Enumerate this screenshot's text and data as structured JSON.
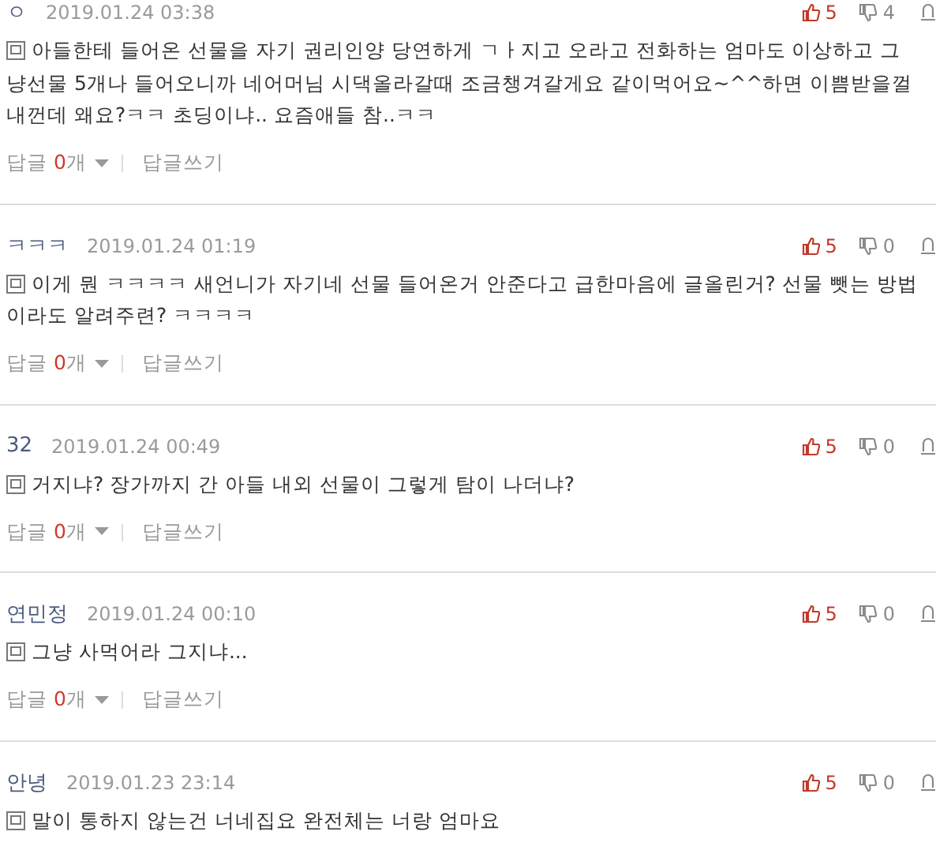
{
  "comments": [
    {
      "author": "ㅇ",
      "date": "2019.01.24 03:38",
      "likes": "5",
      "dislikes": "4",
      "text": "아들한테 들어온 선물을 자기 권리인양 당연하게 ㄱㅏ지고 오라고 전화하는 엄마도 이상하고 그냥선물 5개나 들어오니까 네어머님 시댁올라갈때 조금챙겨갈게요 같이먹어요~^^하면 이쁨받을껄 내껀데 왜요?ㅋㅋ 초딩이냐.. 요즘애들 참..ㅋㅋ",
      "reply_label": "답글",
      "reply_count": "0",
      "reply_unit": "개",
      "write_label": "답글쓰기"
    },
    {
      "author": "ㅋㅋㅋ",
      "date": "2019.01.24 01:19",
      "likes": "5",
      "dislikes": "0",
      "text": "이게 뭔 ㅋㅋㅋㅋ 새언니가 자기네 선물 들어온거 안준다고 급한마음에 글올린거? 선물 뺏는 방법이라도 알려주련? ㅋㅋㅋㅋ",
      "reply_label": "답글",
      "reply_count": "0",
      "reply_unit": "개",
      "write_label": "답글쓰기"
    },
    {
      "author": "32",
      "date": "2019.01.24 00:49",
      "likes": "5",
      "dislikes": "0",
      "text": "거지냐? 장가까지 간 아들 내외 선물이 그렇게 탐이 나더냐?",
      "reply_label": "답글",
      "reply_count": "0",
      "reply_unit": "개",
      "write_label": "답글쓰기"
    },
    {
      "author": "연민정",
      "date": "2019.01.24 00:10",
      "likes": "5",
      "dislikes": "0",
      "text": "그냥 사먹어라 그지냐...",
      "reply_label": "답글",
      "reply_count": "0",
      "reply_unit": "개",
      "write_label": "답글쓰기"
    },
    {
      "author": "안녕",
      "date": "2019.01.23 23:14",
      "likes": "5",
      "dislikes": "0",
      "text": "말이 통하지 않는건 너네집요 완전체는 너랑 엄마요"
    }
  ]
}
